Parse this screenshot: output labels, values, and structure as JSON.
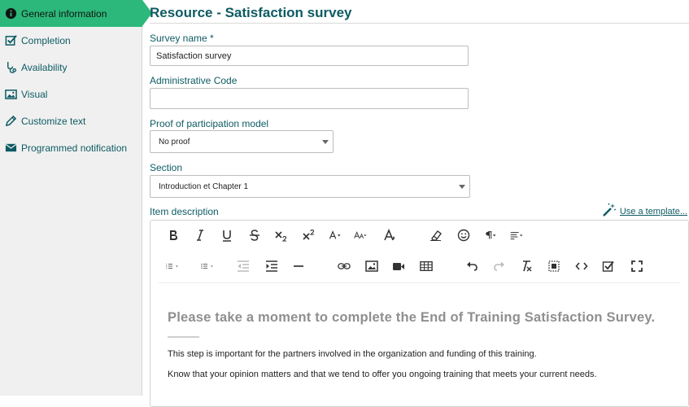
{
  "sidebar": {
    "items": [
      {
        "label": "General information",
        "icon": "info-circle-icon",
        "active": true
      },
      {
        "label": "Completion",
        "icon": "checkbox-icon"
      },
      {
        "label": "Availability",
        "icon": "stethoscope-icon"
      },
      {
        "label": "Visual",
        "icon": "image-icon"
      },
      {
        "label": "Customize text",
        "icon": "pencil-icon"
      },
      {
        "label": "Programmed notification",
        "icon": "envelope-icon"
      }
    ]
  },
  "main": {
    "title": "Resource - Satisfaction survey",
    "survey_name": {
      "label": "Survey name *",
      "value": "Satisfaction survey"
    },
    "admin_code": {
      "label": "Administrative Code",
      "value": ""
    },
    "proof_model": {
      "label": "Proof of participation model",
      "selected": "No proof"
    },
    "section": {
      "label": "Section",
      "selected": "Introduction et Chapter 1"
    },
    "item_description": {
      "label": "Item description"
    },
    "use_template": "Use a template..."
  },
  "editor": {
    "heading": "Please take a moment to complete the End of Training Satisfaction Survey.",
    "paragraphs": [
      "This step is important for the partners involved in the organization and funding of this training.",
      "Know that your opinion matters and that we tend to offer you ongoing training that meets your current needs."
    ]
  },
  "colors": {
    "accent": "#2bb87a",
    "brand_text": "#0d5b63"
  }
}
